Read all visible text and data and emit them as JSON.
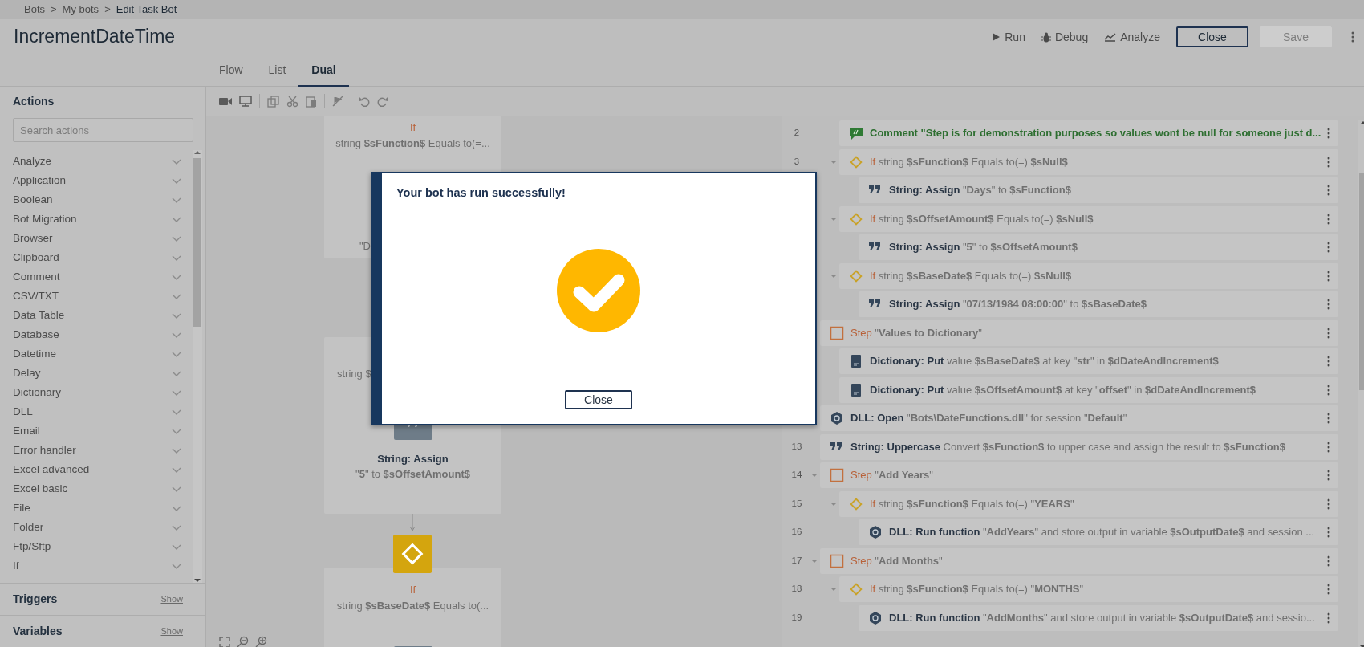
{
  "breadcrumb": [
    {
      "kind": "link",
      "text": "Bots"
    },
    {
      "kind": "sep",
      "text": ">"
    },
    {
      "kind": "link",
      "text": "My bots"
    },
    {
      "kind": "sep",
      "text": ">"
    },
    {
      "kind": "current",
      "text": "Edit Task Bot"
    }
  ],
  "title": "IncrementDateTime",
  "header_actions": [
    {
      "kind": "run",
      "label": "Run"
    },
    {
      "kind": "debug",
      "label": "Debug"
    },
    {
      "kind": "analyze",
      "label": "Analyze"
    }
  ],
  "header_buttons": [
    {
      "label": "Close",
      "disabled": false
    },
    {
      "label": "Save",
      "disabled": true
    }
  ],
  "tabs": [
    {
      "label": "Flow",
      "selected": false
    },
    {
      "label": "List",
      "selected": false
    },
    {
      "label": "Dual",
      "selected": true
    }
  ],
  "sidebar": {
    "title": "Actions",
    "search": {
      "placeholder": "Search actions"
    },
    "categories": [
      {
        "label": "Analyze",
        "expanded": false
      },
      {
        "label": "Application",
        "expanded": false
      },
      {
        "label": "Boolean",
        "expanded": false
      },
      {
        "label": "Bot Migration",
        "expanded": false
      },
      {
        "label": "Browser",
        "expanded": false
      },
      {
        "label": "Clipboard",
        "expanded": false
      },
      {
        "label": "Comment",
        "expanded": false
      },
      {
        "label": "CSV/TXT",
        "expanded": false
      },
      {
        "label": "Data Table",
        "expanded": false
      },
      {
        "label": "Database",
        "expanded": false
      },
      {
        "label": "Datetime",
        "expanded": false
      },
      {
        "label": "Delay",
        "expanded": false
      },
      {
        "label": "Dictionary",
        "expanded": false
      },
      {
        "label": "DLL",
        "expanded": false
      },
      {
        "label": "Email",
        "expanded": false
      },
      {
        "label": "Error handler",
        "expanded": false
      },
      {
        "label": "Excel advanced",
        "expanded": false
      },
      {
        "label": "Excel basic",
        "expanded": false
      },
      {
        "label": "File",
        "expanded": false
      },
      {
        "label": "Folder",
        "expanded": false
      },
      {
        "label": "Ftp/Sftp",
        "expanded": false
      },
      {
        "label": "If",
        "expanded": false
      }
    ],
    "sections": [
      {
        "label": "Triggers",
        "link": "Show"
      },
      {
        "label": "Variables",
        "link": "Show"
      }
    ]
  },
  "flow": {
    "nodes": [
      {
        "kind": "if",
        "keyword": "If",
        "detail": "string **$sFunction$** Equals to(=...",
        "fragment": "\"D"
      },
      {
        "kind": "assign",
        "fragment": "string $",
        "title": "String: Assign",
        "detail": "\"**5**\" to **$sOffsetAmount$**"
      },
      {
        "kind": "if",
        "keyword": "If",
        "detail": "string **$sBaseDate$** Equals to(..."
      }
    ]
  },
  "list": {
    "rows": [
      {
        "kind": "offscreen",
        "children": [
          {
            "kind": "comment",
            "number": "2",
            "title": "Comment \"Step is for demonstration purposes so values wont be null for someone just d..."
          },
          {
            "kind": "if",
            "number": "3",
            "expanded": true,
            "keyword": "If",
            "detail": "string **$sFunction$** Equals to(=) **$sNull$**",
            "children": [
              {
                "kind": "assign",
                "title": "String: Assign",
                "detail": "\"**Days**\" to **$sFunction$**"
              }
            ]
          },
          {
            "kind": "if",
            "expanded": true,
            "keyword": "If",
            "detail": "string **$sOffsetAmount$** Equals to(=) **$sNull$**",
            "children": [
              {
                "kind": "assign",
                "title": "String: Assign",
                "detail": "\"**5**\" to **$sOffsetAmount$**"
              }
            ]
          },
          {
            "kind": "if",
            "expanded": true,
            "keyword": "If",
            "detail": "string **$sBaseDate$** Equals to(=) **$sNull$**",
            "children": [
              {
                "kind": "assign",
                "title": "String: Assign",
                "detail": "\"**07/13/1984 08:00:00**\" to **$sBaseDate$**"
              }
            ]
          }
        ]
      },
      {
        "kind": "step",
        "keyword": "Step",
        "detail": "\"**Values to Dictionary**\"",
        "children": [
          {
            "kind": "dictionary",
            "title": "Dictionary: Put",
            "detail": "value **$sBaseDate$** at key \"**str**\" in **$dDateAndIncrement$**"
          },
          {
            "kind": "dictionary",
            "title": "Dictionary: Put",
            "detail": "value **$sOffsetAmount$** at key \"**offset**\" in **$dDateAndIncrement$**"
          }
        ]
      },
      {
        "kind": "dll",
        "title": "DLL: Open",
        "detail": "\"**Bots\\DateFunctions.dll**\" for session \"**Default**\""
      },
      {
        "kind": "assign",
        "number": "13",
        "title": "String: Uppercase",
        "detail": "Convert **$sFunction$** to upper case and assign the result to **$sFunction$**"
      },
      {
        "kind": "step",
        "number": "14",
        "expanded": true,
        "keyword": "Step",
        "detail": "\"**Add Years**\"",
        "children": [
          {
            "kind": "if",
            "number": "15",
            "expanded": true,
            "keyword": "If",
            "detail": "string **$sFunction$** Equals to(=) \"**YEARS**\"",
            "children": [
              {
                "kind": "dll",
                "number": "16",
                "title": "DLL: Run function",
                "detail": "\"**AddYears**\" and store output in variable **$sOutputDate$** and session ..."
              }
            ]
          }
        ]
      },
      {
        "kind": "step",
        "number": "17",
        "expanded": true,
        "keyword": "Step",
        "detail": "\"**Add Months**\"",
        "children": [
          {
            "kind": "if",
            "number": "18",
            "expanded": true,
            "keyword": "If",
            "detail": "string **$sFunction$** Equals to(=) \"**MONTHS**\"",
            "children": [
              {
                "kind": "dll",
                "number": "19",
                "title": "DLL: Run function",
                "detail": "\"**AddMonths**\" and store output in variable **$sOutputDate$** and sessio..."
              }
            ]
          }
        ]
      }
    ]
  },
  "dialog": {
    "message": "Your bot has run successfully!",
    "button": "Close"
  }
}
